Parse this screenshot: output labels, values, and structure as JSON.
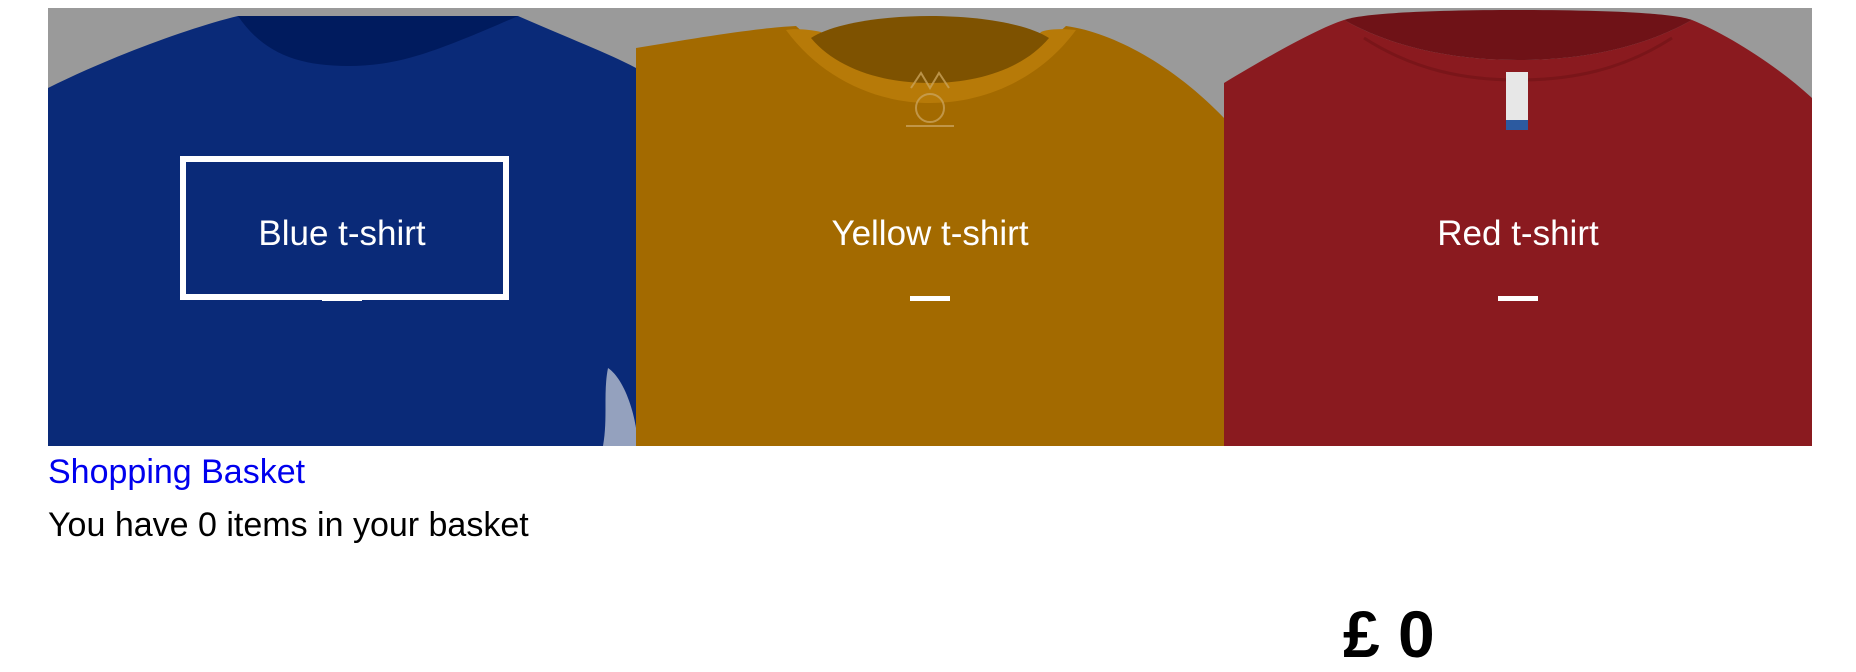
{
  "products": [
    {
      "label": "Blue t-shirt",
      "color": "#0a2a78",
      "shade": "#001b5e",
      "background": "#9a9a9a",
      "focused": true,
      "icon": "blue-tshirt-image"
    },
    {
      "label": "Yellow t-shirt",
      "color": "#a36a00",
      "shade": "#7e5200",
      "background": "#9a9a9a",
      "focused": false,
      "icon": "yellow-tshirt-image"
    },
    {
      "label": "Red t-shirt",
      "color": "#8a1a1f",
      "shade": "#6f1217",
      "background": "#9a9a9a",
      "focused": false,
      "icon": "red-tshirt-image"
    }
  ],
  "basket": {
    "link_label": "Shopping Basket",
    "status": "You have 0 items in your basket",
    "total": "£ 0",
    "item_count": 0
  }
}
